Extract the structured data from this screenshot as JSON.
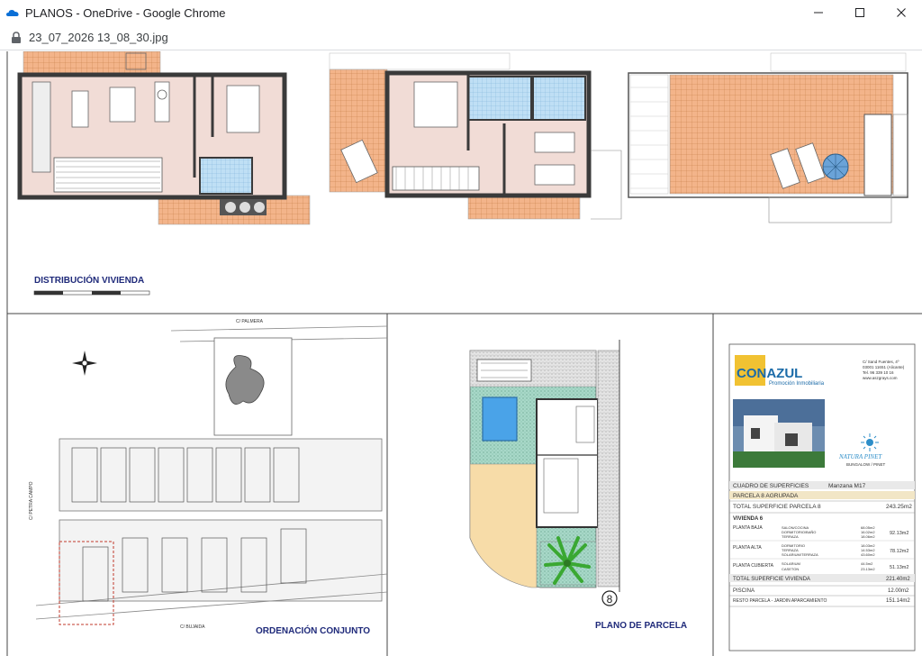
{
  "window": {
    "title": "PLANOS - OneDrive - Google Chrome",
    "controls": {
      "minimize": "—",
      "maximize": "☐",
      "close": "✕"
    },
    "colors": {
      "onedrive": "#0a6fd6"
    }
  },
  "address": {
    "url": "23_07_2026 13_08_30.jpg"
  },
  "drawing": {
    "distribucion_label": "DISTRIBUCIÓN VIVIENDA",
    "ordenacion_label": "ORDENACIÓN CONJUNTO",
    "parcela_label": "PLANO DE PARCELA",
    "parcela_number": "8",
    "street_top": "C/ PALMERA",
    "street_left": "C/ PETRA CAMPO",
    "street_bottom": "C/ BUJAIDA",
    "colors": {
      "tile": "#f3b48a",
      "tile_line": "#c47a45",
      "wall": "#3a3a3a",
      "pink": "#f1dcd6",
      "bath": "#bfdff5",
      "pool": "#4aa3e8",
      "grass": "#a8d8c8",
      "sand": "#f7dca8"
    }
  },
  "legend": {
    "brand": "CONAZUL",
    "brand_sub": "Promoción Inmobiliaria",
    "address_lines": [
      "C/ Sand Fuentes, 4º",
      "03001 11651 (Alicante)",
      "Tel. 96 339 10 16",
      "www.aszgrays.com"
    ],
    "naturapinet": "NATURA PINET",
    "naturapinet_sub": "BUNGALOW / PINET",
    "cuadro_title": "CUADRO DE SUPERFICIES",
    "manzana": "Manzana M17",
    "parcela_row": "PARCELA 8 AGRUPADA",
    "total_parcela_label": "TOTAL SUPERFICIE PARCELA 8",
    "total_parcela_value": "243.25m2",
    "vivienda_label": "VIVIENDA 6",
    "floors": [
      {
        "name": "PLANTA BAJA",
        "items": [
          "SALON/COCINA",
          "DORMITORIO/BAÑO",
          "TERRAZA"
        ],
        "small": [
          "68.05m2",
          "16.02m2",
          "18.06m2"
        ],
        "value": "92.13m2"
      },
      {
        "name": "PLANTA ALTA",
        "items": [
          "DORMITORIO",
          "TERRAZA",
          "SOLARIUM/TERRAZA"
        ],
        "small": [
          "18.03m2",
          "14.53m2",
          "43.60m2"
        ],
        "value": "78.12m2"
      },
      {
        "name": "PLANTA CUBIERTA",
        "items": [
          "SOLARIUM",
          "CASETON"
        ],
        "small": [
          "44.5m2",
          "23.13m2"
        ],
        "value": "51.13m2"
      }
    ],
    "total_vivienda_label": "TOTAL SUPERFICIE VIVIENDA",
    "total_vivienda_value": "221.40m2",
    "piscina_label": "PISCINA",
    "piscina_value": "12.00m2",
    "resto_label": "RESTO PARCELA - JARDIN APARCAMIENTO",
    "resto_value": "151.14m2",
    "colors": {
      "brand_blue": "#1b6ba8",
      "brand_yellow": "#f1c232",
      "row_shade": "#f2e6c6",
      "header": "#e9e9e9"
    }
  }
}
